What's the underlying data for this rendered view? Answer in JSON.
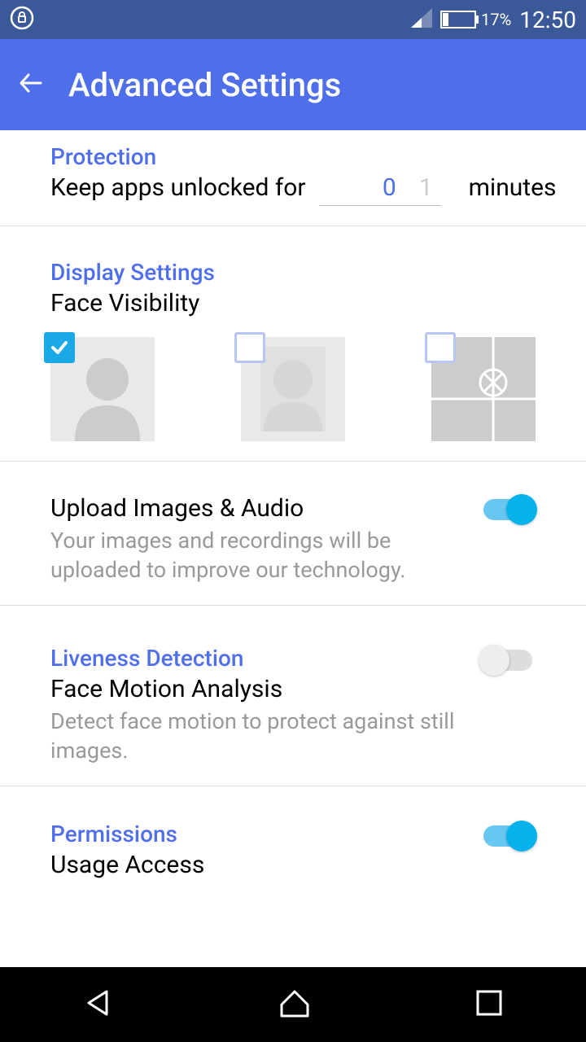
{
  "status": {
    "battery_pct": "17%",
    "time": "12:50"
  },
  "header": {
    "title": "Advanced Settings"
  },
  "protection": {
    "header": "Protection",
    "label": "Keep apps unlocked for",
    "value": "0",
    "placeholder": "1",
    "unit": "minutes"
  },
  "display": {
    "header": "Display Settings",
    "sub": "Face Visibility",
    "options": [
      {
        "checked": true
      },
      {
        "checked": false
      },
      {
        "checked": false
      }
    ]
  },
  "upload": {
    "title": "Upload Images & Audio",
    "desc": "Your images and recordings will be uploaded to improve our technology.",
    "on": true
  },
  "liveness": {
    "header": "Liveness Detection",
    "sub": "Face Motion Analysis",
    "desc": "Detect face motion to protect against still images.",
    "on": false
  },
  "permissions": {
    "header": "Permissions",
    "sub": "Usage Access",
    "on": true
  }
}
